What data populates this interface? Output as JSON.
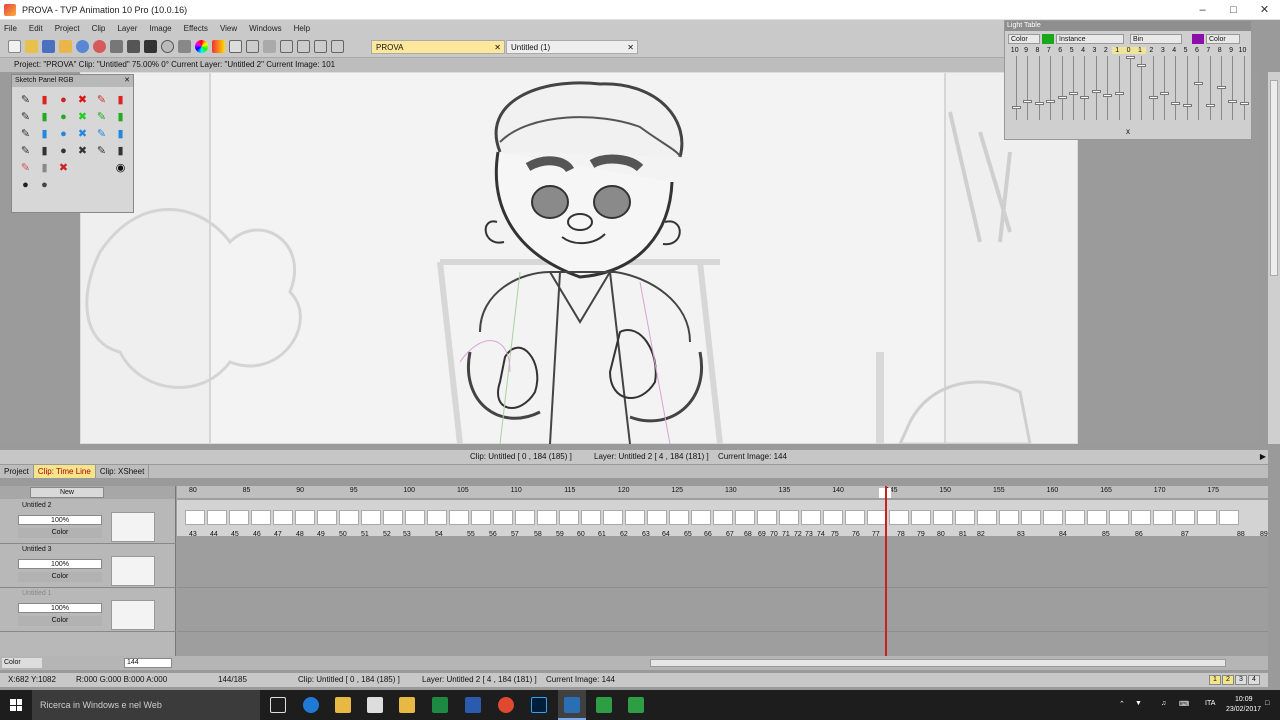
{
  "window": {
    "title": "PROVA - TVP Animation 10 Pro (10.0.16)"
  },
  "menu": [
    "File",
    "Edit",
    "Project",
    "Clip",
    "Layer",
    "Image",
    "Effects",
    "View",
    "Windows",
    "Help"
  ],
  "doc_tabs": {
    "active": "PROVA",
    "other": "Untitled (1)"
  },
  "info_line": "Project: \"PROVA\"  Clip: \"Untitled\"  75.00%  0°  Current Layer: \"Untitled 2\"  Current Image: 101",
  "sketch_panel": {
    "title": "Sketch Panel RGB"
  },
  "light_table": {
    "title": "Light Table",
    "mode": "Color",
    "instance": "Instance",
    "bin": "Bin",
    "color2": "Color",
    "numbers": [
      "10",
      "9",
      "8",
      "7",
      "6",
      "5",
      "4",
      "3",
      "2",
      "1",
      "0",
      "1",
      "2",
      "3",
      "4",
      "5",
      "6",
      "7",
      "8",
      "9",
      "10"
    ],
    "x_label": "x"
  },
  "status_mid": {
    "clip": "Clip: Untitled [ 0 , 184  (185) ]",
    "layer": "Layer: Untitled 2 [ 4 , 184  (181) ]",
    "current": "Current Image: 144"
  },
  "timeline_tabs": [
    "Project",
    "Clip: Time Line",
    "Clip: XSheet"
  ],
  "timeline": {
    "new_label": "New",
    "layers": [
      {
        "name": "Untitled 2",
        "opacity": "100%",
        "mode": "Color"
      },
      {
        "name": "Untitled 3",
        "opacity": "100%",
        "mode": "Color"
      },
      {
        "name": "Untitled 1",
        "opacity": "100%",
        "mode": "Color"
      }
    ],
    "ruler": [
      "80",
      "85",
      "90",
      "95",
      "100",
      "105",
      "110",
      "115",
      "120",
      "125",
      "130",
      "135",
      "140",
      "145",
      "150",
      "155",
      "160",
      "165",
      "170",
      "175"
    ],
    "image_numbers": [
      "43",
      "44",
      "45",
      "46",
      "47",
      "48",
      "49",
      "50",
      "51",
      "52",
      "53",
      "54",
      "55",
      "56",
      "57",
      "58",
      "59",
      "60",
      "61",
      "62",
      "63",
      "64",
      "65",
      "66",
      "67",
      "68",
      "69",
      "70",
      "71",
      "72",
      "73",
      "74",
      "75",
      "76",
      "77",
      "78",
      "79",
      "80",
      "81",
      "82",
      "83",
      "84",
      "85",
      "86",
      "87",
      "88",
      "89"
    ],
    "footer_mode": "Color",
    "frame_value": "144"
  },
  "bottom_status": {
    "coords": "X:682  Y:1082",
    "rgba": "R:000 G:000 B:000 A:000",
    "frame": "144/185",
    "clip": "Clip: Untitled [ 0 , 184  (185) ]",
    "layer": "Layer: Untitled 2 [ 4 , 184  (181) ]",
    "current": "Current Image: 144",
    "pages": [
      "1",
      "2",
      "3",
      "4"
    ]
  },
  "taskbar": {
    "search_placeholder": "Ricerca in Windows e nel Web",
    "lang": "ITA",
    "time": "10:09",
    "date": "23/02/2017"
  },
  "colors": {
    "accent_tab": "#f4e58a",
    "playhead": "#cc1f1f",
    "taskbar": "#1d1d1d"
  }
}
